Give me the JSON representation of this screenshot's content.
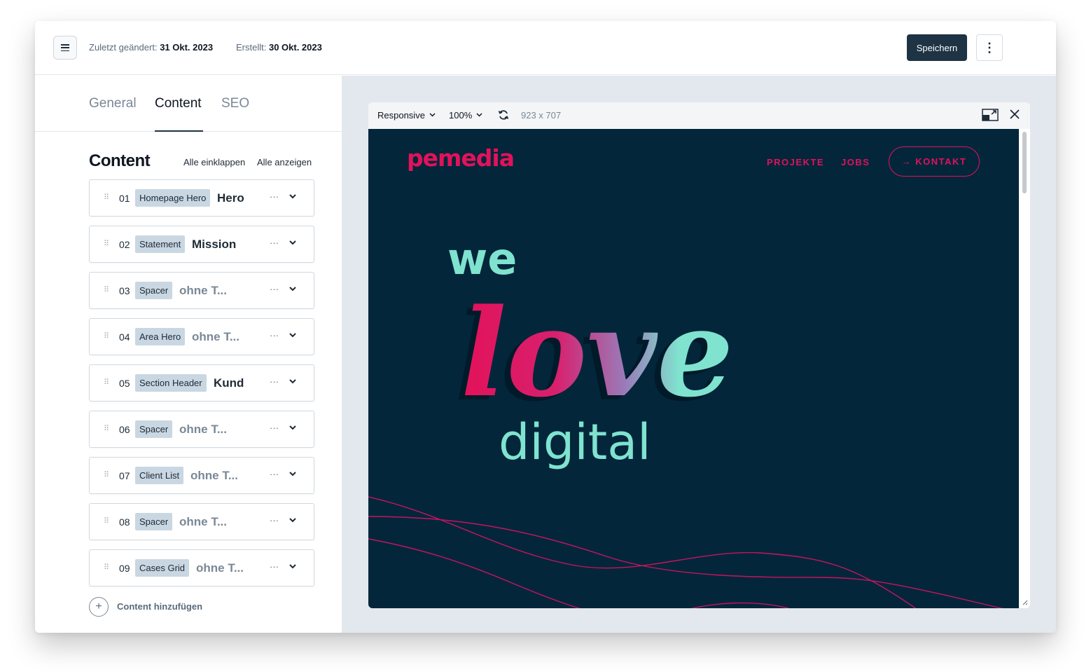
{
  "header": {
    "modified_label": "Zuletzt geändert:",
    "modified_date": "31 Okt. 2023",
    "created_label": "Erstellt:",
    "created_date": "30 Okt. 2023",
    "save_label": "Speichern",
    "more_label": "⋮"
  },
  "tabs": [
    {
      "label": "General"
    },
    {
      "label": "Content",
      "active": true
    },
    {
      "label": "SEO"
    }
  ],
  "content": {
    "title": "Content",
    "collapse_all": "Alle einklappen",
    "show_all": "Alle anzeigen",
    "add_label": "Content hinzufügen",
    "blocks": [
      {
        "num": "01",
        "type": "Homepage Hero",
        "name": "Hero",
        "muted": false
      },
      {
        "num": "02",
        "type": "Statement",
        "name": "Mission",
        "muted": false
      },
      {
        "num": "03",
        "type": "Spacer",
        "name": "ohne T...",
        "muted": true
      },
      {
        "num": "04",
        "type": "Area Hero",
        "name": "ohne T...",
        "muted": true
      },
      {
        "num": "05",
        "type": "Section Header",
        "name": "Kund",
        "muted": false
      },
      {
        "num": "06",
        "type": "Spacer",
        "name": "ohne T...",
        "muted": true
      },
      {
        "num": "07",
        "type": "Client List",
        "name": "ohne T...",
        "muted": true
      },
      {
        "num": "08",
        "type": "Spacer",
        "name": "ohne T...",
        "muted": true
      },
      {
        "num": "09",
        "type": "Cases Grid",
        "name": "ohne T...",
        "muted": true
      }
    ],
    "block_menu": "···"
  },
  "preview": {
    "viewport": "Responsive",
    "zoom": "100%",
    "dims": "923 x 707"
  },
  "site": {
    "logo": "pemedia",
    "nav": [
      "PROJEKTE",
      "JOBS"
    ],
    "cta": "→ KONTAKT",
    "hero_line1": "we",
    "hero_line2": "love",
    "hero_line3": "digital"
  },
  "colors": {
    "brand_pink": "#e2125a",
    "site_bg": "#03263b",
    "hero_mint": "#7fe3cf",
    "save_btn": "#1e3344"
  }
}
